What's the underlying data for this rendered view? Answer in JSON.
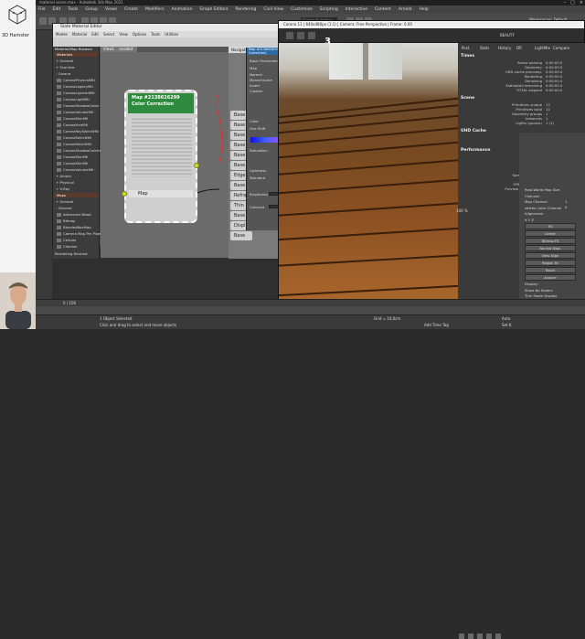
{
  "brand": {
    "name": "3D Hamster"
  },
  "app": {
    "title": "material scene.max - Autodesk 3ds Max 2021",
    "menu": [
      "File",
      "Edit",
      "Tools",
      "Group",
      "Views",
      "Create",
      "Modifiers",
      "Animation",
      "Graph Editors",
      "Rendering",
      "Civil View",
      "Customize",
      "Scripting",
      "Interactive",
      "Content",
      "Arnold",
      "Help"
    ],
    "workspace": "Workspaces: Default",
    "search_placeholder": "Create Selection Se"
  },
  "slate": {
    "title": "Slate Material Editor",
    "menu": [
      "Modes",
      "Material",
      "Edit",
      "Select",
      "View",
      "Options",
      "Tools",
      "Utilities"
    ],
    "view_tab": "View1",
    "view_tab_extra": "ncoded",
    "browser_title": "Material/Map Browser",
    "browser_items": [
      {
        "label": "Materials",
        "type": "section"
      },
      {
        "label": "+ General",
        "type": "row"
      },
      {
        "label": "+ Scanline",
        "type": "row"
      },
      {
        "label": "- Corona",
        "type": "row"
      },
      {
        "label": "CoronaPhysicalMtl",
        "type": "item"
      },
      {
        "label": "CoronaLegacyMtl",
        "type": "item"
      },
      {
        "label": "CoronaLayeredMtl",
        "type": "item"
      },
      {
        "label": "CoronaLightMtl",
        "type": "item"
      },
      {
        "label": "CoronaShadowCatch",
        "type": "item"
      },
      {
        "label": "CoronaVolumeMtl",
        "type": "item"
      },
      {
        "label": "CoronaSkinMtl",
        "type": "item"
      },
      {
        "label": "CoronaHairMtl",
        "type": "item"
      },
      {
        "label": "CoronaRaySwitchMtl",
        "type": "item"
      },
      {
        "label": "CoronaSelectMtl",
        "type": "item"
      },
      {
        "label": "CoronaSelectMtl",
        "type": "item"
      },
      {
        "label": "CoronaShadowCatcher",
        "type": "item"
      },
      {
        "label": "CoronaSkinMtl",
        "type": "item"
      },
      {
        "label": "CoronaSkinMtl",
        "type": "item"
      },
      {
        "label": "CoronaVolumeMtl",
        "type": "item"
      },
      {
        "label": "+ Arnold",
        "type": "row"
      },
      {
        "label": "+ Physical",
        "type": "row"
      },
      {
        "label": "+ V-Ray",
        "type": "row"
      },
      {
        "label": "Maps",
        "type": "section"
      },
      {
        "label": "+ General",
        "type": "row"
      },
      {
        "label": "- General",
        "type": "row"
      },
      {
        "label": "Advanced Wood",
        "type": "item"
      },
      {
        "label": "Bitmap",
        "type": "item"
      },
      {
        "label": "BlendedBoxMap",
        "type": "item"
      },
      {
        "label": "Camera Map Per Pixel",
        "type": "item"
      },
      {
        "label": "Cellular",
        "type": "item"
      },
      {
        "label": "Checker",
        "type": "item"
      }
    ],
    "status": "Rendering finished",
    "node": {
      "title": "Map #2138626299",
      "subtitle": "Color Correction",
      "slot": "Map"
    },
    "navigator_title": "Navigator",
    "bases": [
      "Base",
      "Base",
      "Base",
      "Base",
      "Base",
      "Base",
      "Edge",
      "Base",
      "Refra",
      "Thin",
      "Base",
      "Displ",
      "Base"
    ],
    "params": {
      "header": "Map #2138626299 (Color Correction)",
      "basic_label": "Basic Parameters",
      "map_label": "Map",
      "channels": [
        "Normal",
        "Monochrome",
        "Invert",
        "Custom"
      ],
      "color_label": "Color",
      "hue_shift_label": "Hue Shift",
      "saturation_label": "Saturation",
      "lightness_label": "Lightness",
      "standard_label": "Standard",
      "brightness_label": "Brightness",
      "brightness_value": "47,000",
      "contrast_label": "Contrast",
      "contrast_value": "80,000"
    }
  },
  "vfb": {
    "title": "Corona 11 | 640x480px (1:1) | Camera: Free Perspective | Frame: 0.00",
    "pass_number": "3",
    "beauty": "BEAUTY",
    "zoom": "100 %",
    "tabs": [
      "Post",
      "Stats",
      "History",
      "DR",
      "LightMix",
      "Compare"
    ],
    "times_head": "Times",
    "times": [
      {
        "label": "Scene parsing",
        "value": "0:00:00.0"
      },
      {
        "label": "Geometry",
        "value": "0:00:00.0"
      },
      {
        "label": "UHD cache precomp.",
        "value": "0:00:00.0"
      },
      {
        "label": "Rendering",
        "value": "0:00:00.0"
      },
      {
        "label": "Denoising",
        "value": "0:00:00.0"
      },
      {
        "label": "Estimated remaining",
        "value": "0:00:00.0"
      },
      {
        "label": "TOTAL elapsed",
        "value": "0:00:00.0"
      }
    ],
    "scene_head": "Scene",
    "scene": [
      {
        "label": "Primitives unique",
        "value": "12"
      },
      {
        "label": "Primitives total",
        "value": "12"
      },
      {
        "label": "Geometry groups",
        "value": "1"
      },
      {
        "label": "Instances",
        "value": "1"
      },
      {
        "label": "Lights (groups)",
        "value": "1 (1)"
      }
    ],
    "uhd_head": "UHD Cache",
    "uhd": [
      {
        "label": "Records",
        "value": "0"
      },
      {
        "label": "Success rate",
        "value": "0 %"
      }
    ],
    "perf_head": "Performance",
    "perf": [
      {
        "label": "Passes total",
        "value": "72000"
      },
      {
        "label": "Noise level",
        "value": "15.74 %"
      },
      {
        "label": "Rays/sample",
        "value": "6 294 960"
      },
      {
        "label": "Rays/s actual",
        "value": "6 208 790"
      },
      {
        "label": "Samples/s actual",
        "value": "298 333"
      },
      {
        "label": "Rays/sample",
        "value": "16.27"
      },
      {
        "label": "VFB refresh time",
        "value": "0 ms"
      },
      {
        "label": "Preview denoise time",
        "value": "0 ms"
      }
    ]
  },
  "command": {
    "items": [
      "Real-World Map Size",
      "Channel:",
      "Map Channel",
      "Vertex Color Channel",
      "Alignment:",
      "X  Y  Z",
      "Fit",
      "Center",
      "Bitmap Fit",
      "Normal Align",
      "View Align",
      "Region Fit",
      "Reset",
      "Acquire",
      "Display:",
      "Show No Seams",
      "Thin Seam Display",
      "Thick Seam Display"
    ],
    "spinner_values": [
      "1",
      "0"
    ]
  },
  "statusbar": {
    "objects": "1 Object Selected",
    "hint": "Click and drag to select and move objects",
    "time_label": "Add Time Tag",
    "frame": "0 / 100",
    "grid": "Grid = 10,0cm",
    "auto": "Auto",
    "setkey": "Set K."
  }
}
